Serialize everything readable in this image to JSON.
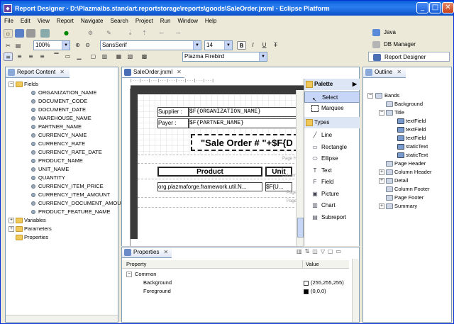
{
  "window": {
    "title": "Report Designer - D:\\Plazma\\bs.standart.reportstorage\\reports\\goods\\SaleOrder.jrxml - Eclipse Platform"
  },
  "menu": [
    "File",
    "Edit",
    "View",
    "Report",
    "Navigate",
    "Search",
    "Project",
    "Run",
    "Window",
    "Help"
  ],
  "toolbar": {
    "zoom": "100%",
    "font": "SansSerif",
    "size": "14",
    "pdf_font": "Plazma Firebird",
    "bold": "B",
    "italic": "I",
    "underline": "U",
    "strike": "T"
  },
  "perspectives": [
    "Java",
    "DB Manager",
    "Report Designer"
  ],
  "report_content": {
    "tab": "Report Content",
    "fields_label": "Fields",
    "fields": [
      "ORGANIZATION_NAME",
      "DOCUMENT_CODE",
      "DOCUMENT_DATE",
      "WAREHOUSE_NAME",
      "PARTNER_NAME",
      "CURRENCY_NAME",
      "CURRENCY_RATE",
      "CURRENCY_RATE_DATE",
      "PRODUCT_NAME",
      "UNIT_NAME",
      "QUANTITY",
      "CURRENCY_ITEM_PRICE",
      "CURRENCY_ITEM_AMOUNT",
      "CURRENCY_DOCUMENT_AMOUN",
      "PRODUCT_FEATURE_NAME"
    ],
    "others": [
      "Variables",
      "Parameters",
      "Properties"
    ]
  },
  "editor": {
    "tab": "SaleOrder.jrxml",
    "supplier_label": "Supplier :",
    "supplier_value": "$F{ORGANIZATION_NAME}",
    "payer_label": "Payer :",
    "payer_value": "$F{PARTNER_NAME}",
    "title_expr": "\"Sale Order # \"+$F{D",
    "page_label": "Page H",
    "col_product": "Product",
    "col_unit": "Unit",
    "col_label": "Column",
    "detail_expr": "org.plazmaforge.framework.util.N...",
    "detail_expr2": "$F{U...",
    "detail_label": "Page",
    "page_label2": "Page"
  },
  "palette": {
    "title": "Palette",
    "tools": [
      "Select",
      "Marquee"
    ],
    "types_label": "Types",
    "types": [
      "Line",
      "Rectangle",
      "Ellipse",
      "Text",
      "Field",
      "Picture",
      "Chart",
      "Subreport"
    ]
  },
  "outline": {
    "tab": "Outline",
    "bands_label": "Bands",
    "items": [
      {
        "label": "Background",
        "level": 1
      },
      {
        "label": "Title",
        "level": 1
      },
      {
        "label": "textField",
        "level": 2
      },
      {
        "label": "textField",
        "level": 2
      },
      {
        "label": "textField",
        "level": 2
      },
      {
        "label": "staticText",
        "level": 2
      },
      {
        "label": "staticText",
        "level": 2
      },
      {
        "label": "Page Header",
        "level": 1
      },
      {
        "label": "Column Header",
        "level": 1
      },
      {
        "label": "Detail",
        "level": 1
      },
      {
        "label": "Column Footer",
        "level": 1
      },
      {
        "label": "Page Footer",
        "level": 1
      },
      {
        "label": "Summary",
        "level": 1
      }
    ]
  },
  "properties": {
    "tab": "Properties",
    "col_property": "Property",
    "col_value": "Value",
    "group": "Common",
    "rows": [
      {
        "name": "Background",
        "value": "(255,255,255)",
        "swatch": "#ffffff"
      },
      {
        "name": "Foreground",
        "value": "(0,0,0)",
        "swatch": "#000000"
      }
    ]
  }
}
